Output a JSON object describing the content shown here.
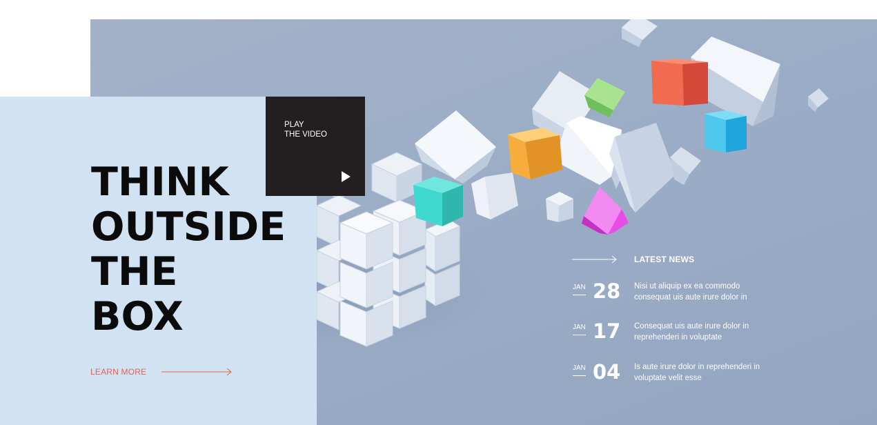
{
  "hero": {
    "headline": [
      "THINK",
      "OUTSIDE",
      "THE",
      "BOX"
    ],
    "learn_more_label": "LEARN MORE"
  },
  "video": {
    "label_line1": "PLAY",
    "label_line2": "THE VIDEO"
  },
  "news": {
    "title": "LATEST NEWS",
    "items": [
      {
        "month": "JAN",
        "day": "28",
        "line1": "Nisi ut aliquip ex ea commodo",
        "line2": "consequat uis aute irure dolor in"
      },
      {
        "month": "JAN",
        "day": "17",
        "line1": "Consequat uis aute irure dolor in",
        "line2": "reprehenderi in voluptate"
      },
      {
        "month": "JAN",
        "day": "04",
        "line1": "Is aute irure dolor in reprehenderi in",
        "line2": "voluptate velit esse"
      }
    ]
  },
  "colors": {
    "accent": "#e8604c",
    "hero_background": "#9badc6",
    "panel": "#d1e2f3",
    "video_box": "#231f20",
    "cube_red": "#f26a4f",
    "cube_green": "#8fd57a",
    "cube_blue": "#4ec8ef",
    "cube_orange": "#f6ad3b",
    "cube_teal": "#3fd9cf",
    "cube_magenta": "#e84de8"
  }
}
